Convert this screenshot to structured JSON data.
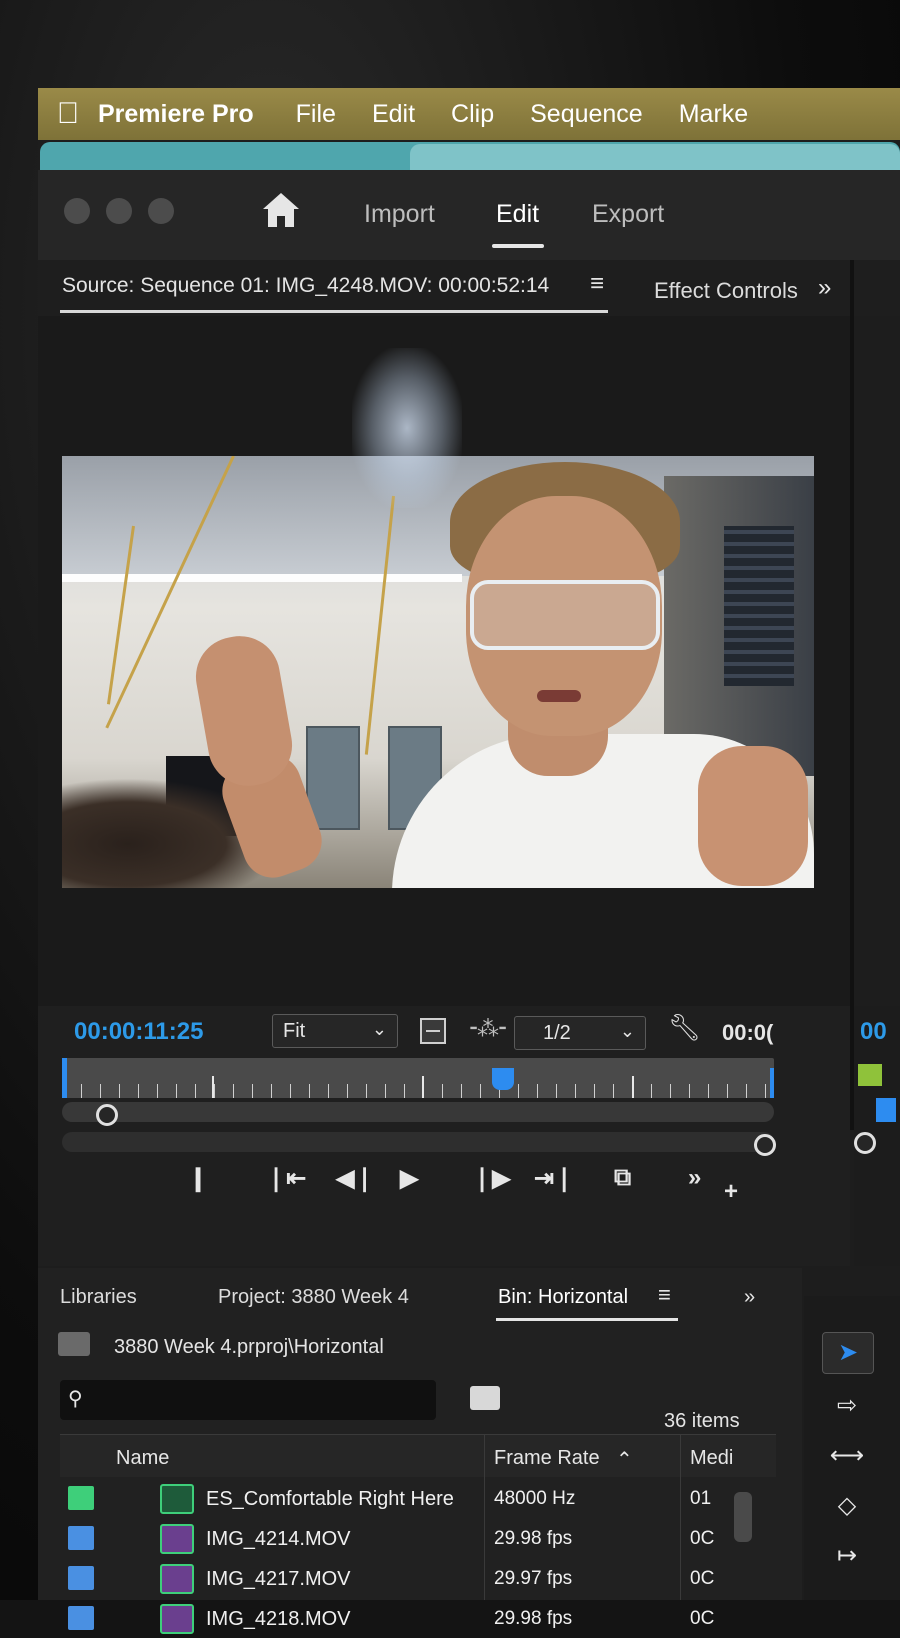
{
  "menubar": {
    "app": "Premiere Pro",
    "items": [
      "File",
      "Edit",
      "Clip",
      "Sequence",
      "Marke"
    ]
  },
  "workspaces": {
    "import": "Import",
    "edit": "Edit",
    "export": "Export"
  },
  "source_panel": {
    "tab_label": "Source: Sequence 01: IMG_4248.MOV: 00:00:52:14",
    "menu_glyph": "≡",
    "effect_controls": "Effect Controls",
    "more_glyph": "»"
  },
  "monitor": {
    "timecode": "00:00:11:25",
    "zoom": "Fit",
    "resolution": "1/2",
    "duration_partial": "00:0(",
    "playhead_fraction": 0.62
  },
  "right_peek": {
    "timecode_partial": "00"
  },
  "project_panel": {
    "tabs": {
      "libraries": "Libraries",
      "project": "Project: 3880 Week 4",
      "bin": "Bin: Horizontal"
    },
    "path": "3880 Week 4.prproj\\Horizontal",
    "search_placeholder": "",
    "item_count": "36 items",
    "columns": {
      "name": "Name",
      "frame_rate": "Frame Rate",
      "media": "Medi"
    },
    "rows": [
      {
        "name": "ES_Comfortable Right Here",
        "frame_rate": "48000 Hz",
        "media": "01",
        "label_color": "#3ecf7a",
        "type": "audio"
      },
      {
        "name": "IMG_4214.MOV",
        "frame_rate": "29.98 fps",
        "media": "0C",
        "label_color": "#4a90e2",
        "type": "video"
      },
      {
        "name": "IMG_4217.MOV",
        "frame_rate": "29.97 fps",
        "media": "0C",
        "label_color": "#4a90e2",
        "type": "video"
      },
      {
        "name": "IMG_4218.MOV",
        "frame_rate": "29.98 fps",
        "media": "0C",
        "label_color": "#4a90e2",
        "type": "video"
      }
    ]
  },
  "colors": {
    "accent_blue": "#2d9ae8",
    "menubar": "#8a7d40",
    "teal": "#4fa6ad"
  }
}
